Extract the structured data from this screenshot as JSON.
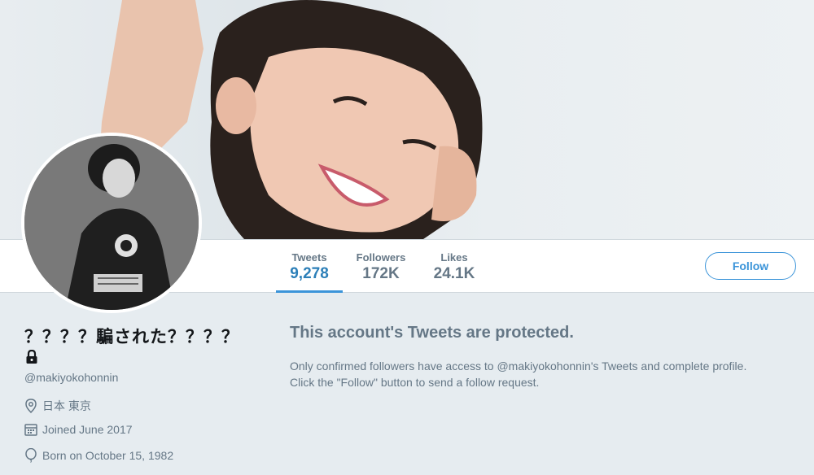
{
  "stats": {
    "tweets": {
      "label": "Tweets",
      "value": "9,278"
    },
    "followers": {
      "label": "Followers",
      "value": "172K"
    },
    "likes": {
      "label": "Likes",
      "value": "24.1K"
    }
  },
  "follow_button": "Follow",
  "profile": {
    "name": "？？？？騙された？？？？",
    "screen_name": "@makiyokohonnin",
    "location": "日本 東京",
    "joined": "Joined June 2017",
    "born": "Born on October 15, 1982"
  },
  "protected": {
    "title": "This account's Tweets are protected.",
    "line1": "Only confirmed followers have access to @makiyokohonnin's Tweets and complete profile.",
    "line2": "Click the \"Follow\" button to send a follow request."
  },
  "colors": {
    "accent": "#3b94d9",
    "muted": "#657786",
    "background": "#e6ecf0"
  },
  "icons": [
    "lock-icon",
    "location-icon",
    "calendar-icon",
    "balloon-icon"
  ]
}
